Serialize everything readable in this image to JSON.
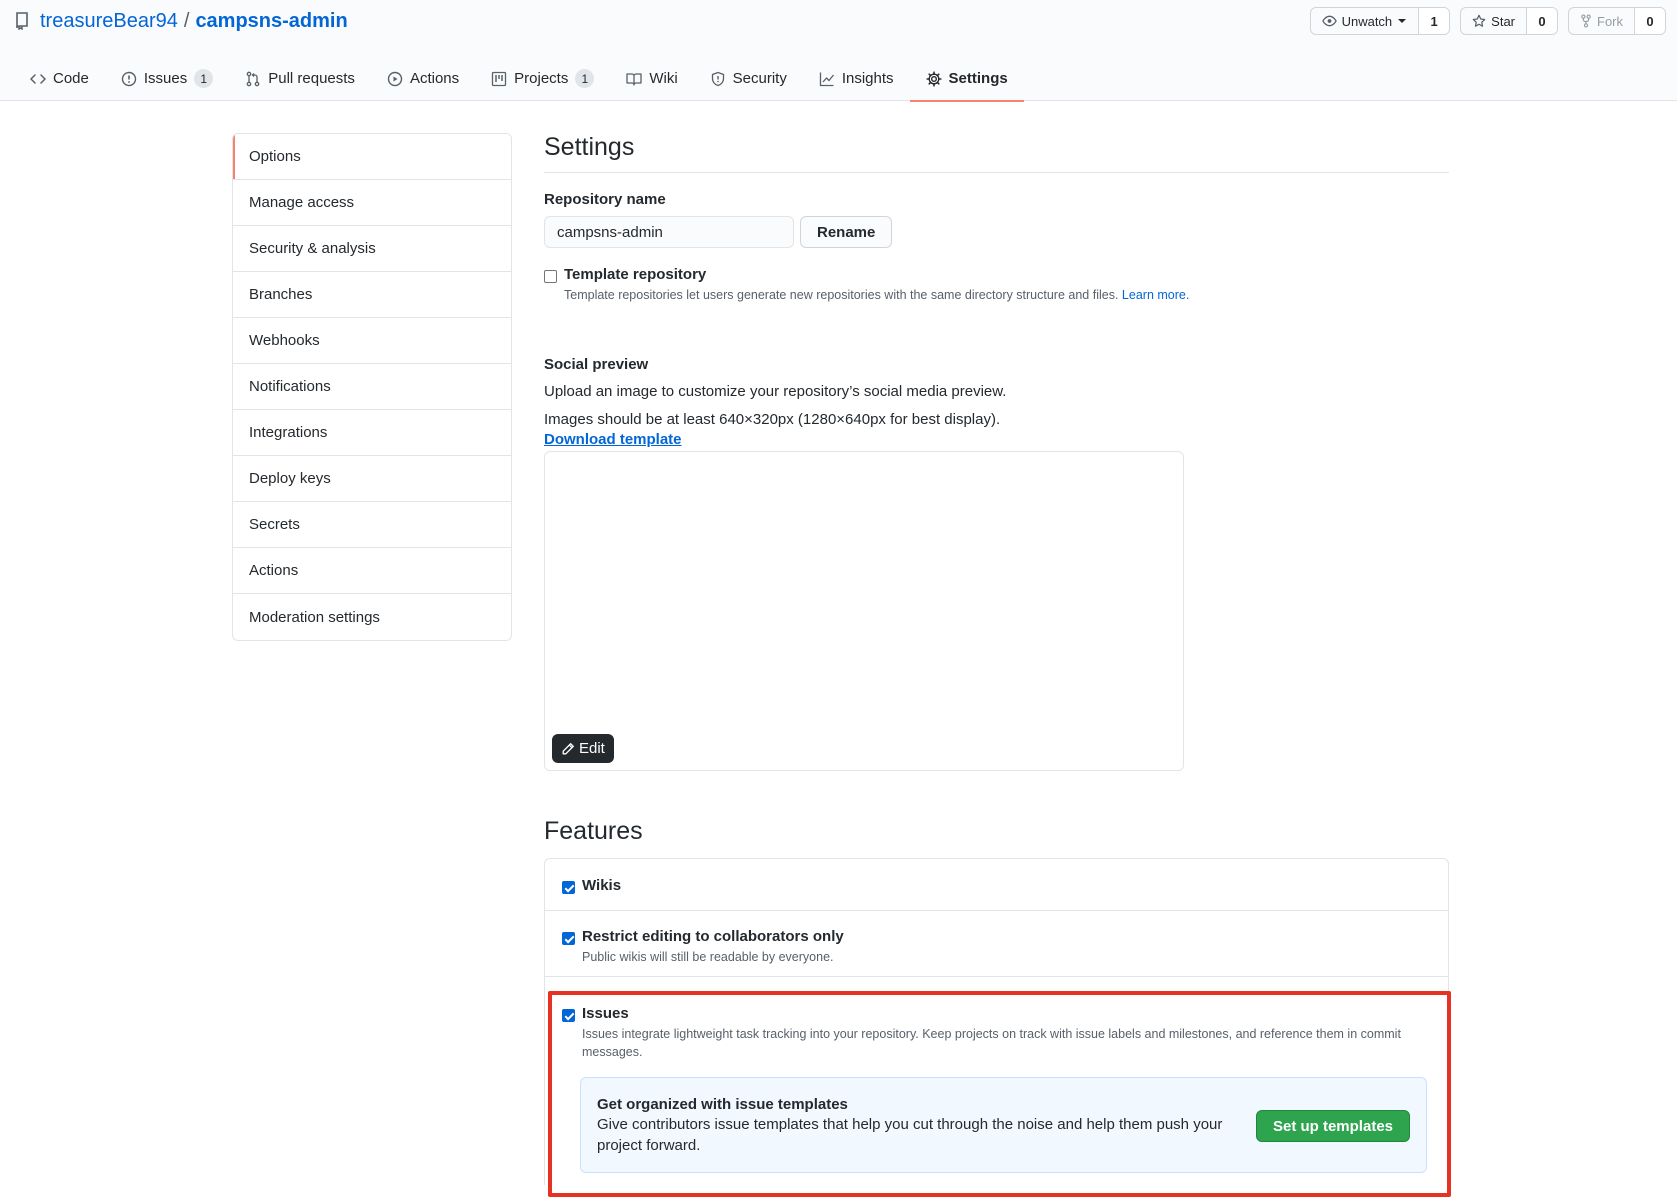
{
  "repo": {
    "owner": "treasureBear94",
    "separator": "/",
    "name": "campsns-admin"
  },
  "actions": {
    "watch": {
      "label": "Unwatch",
      "count": "1"
    },
    "star": {
      "label": "Star",
      "count": "0"
    },
    "fork": {
      "label": "Fork",
      "count": "0"
    }
  },
  "tabs": [
    {
      "label": "Code",
      "icon": "code-icon"
    },
    {
      "label": "Issues",
      "icon": "issue-icon",
      "counter": "1"
    },
    {
      "label": "Pull requests",
      "icon": "pull-request-icon"
    },
    {
      "label": "Actions",
      "icon": "play-icon"
    },
    {
      "label": "Projects",
      "icon": "project-icon",
      "counter": "1"
    },
    {
      "label": "Wiki",
      "icon": "book-icon"
    },
    {
      "label": "Security",
      "icon": "shield-icon"
    },
    {
      "label": "Insights",
      "icon": "graph-icon"
    },
    {
      "label": "Settings",
      "icon": "gear-icon",
      "selected": true
    }
  ],
  "sidebar": {
    "items": [
      {
        "label": "Options",
        "selected": true
      },
      {
        "label": "Manage access"
      },
      {
        "label": "Security & analysis"
      },
      {
        "label": "Branches"
      },
      {
        "label": "Webhooks"
      },
      {
        "label": "Notifications"
      },
      {
        "label": "Integrations"
      },
      {
        "label": "Deploy keys"
      },
      {
        "label": "Secrets"
      },
      {
        "label": "Actions"
      },
      {
        "label": "Moderation settings"
      }
    ]
  },
  "settings": {
    "title": "Settings",
    "repo_name_label": "Repository name",
    "repo_name_value": "campsns-admin",
    "rename_label": "Rename",
    "template": {
      "title": "Template repository",
      "note": "Template repositories let users generate new repositories with the same directory structure and files.",
      "link": "Learn more.",
      "checked": false
    },
    "social": {
      "title": "Social preview",
      "desc": "Upload an image to customize your repository’s social media preview.",
      "size_note": "Images should be at least 640×320px (1280×640px for best display).",
      "download": "Download template",
      "edit": "Edit"
    }
  },
  "features": {
    "title": "Features",
    "wikis": {
      "label": "Wikis",
      "checked": true
    },
    "restrict": {
      "label": "Restrict editing to collaborators only",
      "note": "Public wikis will still be readable by everyone.",
      "checked": true
    },
    "issues": {
      "label": "Issues",
      "note": "Issues integrate lightweight task tracking into your repository. Keep projects on track with issue labels and milestones, and reference them in commit messages.",
      "checked": true,
      "callout_title": "Get organized with issue templates",
      "callout_desc": "Give contributors issue templates that help you cut through the noise and help them push your project forward.",
      "button": "Set up templates"
    }
  },
  "colors": {
    "link": "#0366d6",
    "tab_underline": "#f9826c",
    "primary": "#2ea44f",
    "highlight": "#e53222"
  }
}
